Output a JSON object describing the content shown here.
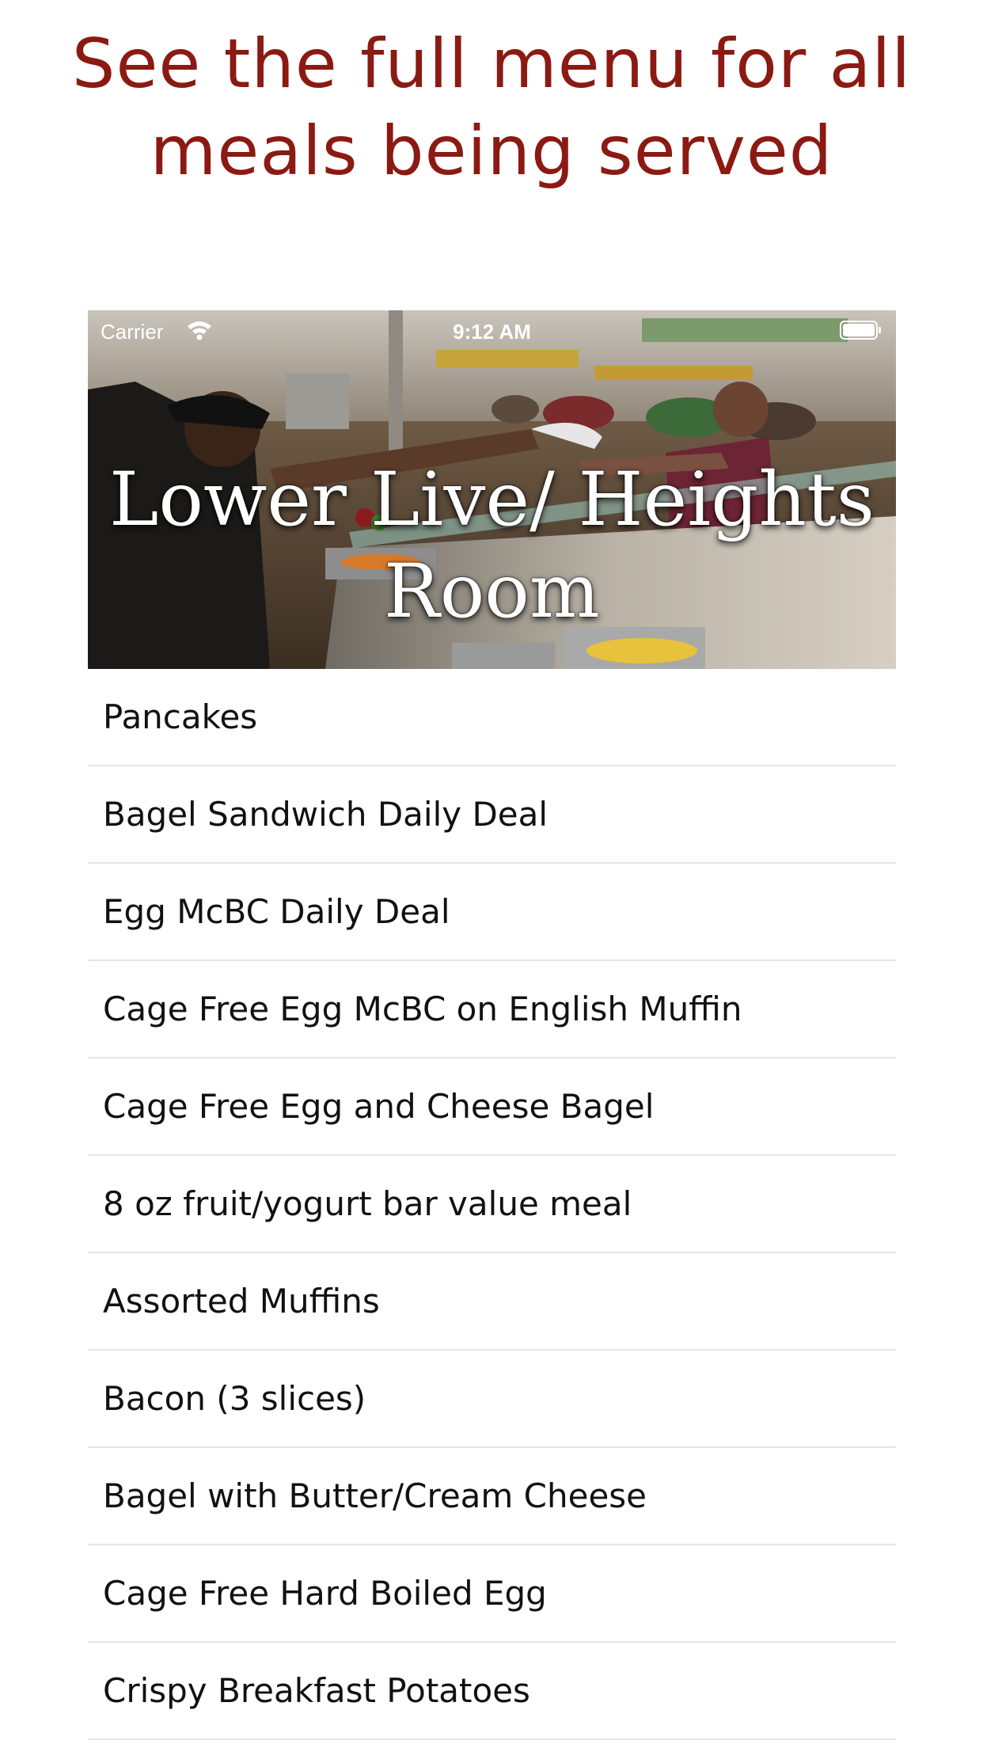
{
  "headline": {
    "text": "See the full menu for all meals being served",
    "color": "#8b1a12"
  },
  "hero": {
    "status_bar": {
      "carrier": "Carrier",
      "time": "9:12 AM",
      "wifi_icon": "wifi-icon",
      "battery_icon": "battery-icon"
    },
    "title": "Lower Live/ Heights Room"
  },
  "menu": {
    "items": [
      {
        "label": "Pancakes"
      },
      {
        "label": "Bagel Sandwich Daily Deal"
      },
      {
        "label": "Egg McBC Daily Deal"
      },
      {
        "label": "Cage Free Egg McBC on English Muffin"
      },
      {
        "label": "Cage Free Egg and Cheese Bagel"
      },
      {
        "label": "8 oz fruit/yogurt bar value meal"
      },
      {
        "label": "Assorted Muffins"
      },
      {
        "label": "Bacon (3 slices)"
      },
      {
        "label": "Bagel with Butter/Cream Cheese"
      },
      {
        "label": "Cage Free Hard Boiled Egg"
      },
      {
        "label": "Crispy Breakfast Potatoes"
      }
    ]
  }
}
